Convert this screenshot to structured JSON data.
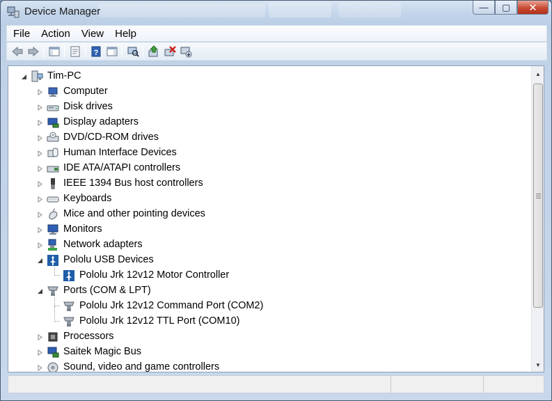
{
  "window": {
    "title": "Device Manager",
    "controls": {
      "minimize": "—",
      "maximize": "▢",
      "close": "✕"
    }
  },
  "menu": [
    "File",
    "Action",
    "View",
    "Help"
  ],
  "toolbar": [
    {
      "icon": "back-arrow-icon"
    },
    {
      "icon": "forward-arrow-icon"
    },
    {
      "sep": true
    },
    {
      "icon": "show-hide-console-tree-icon"
    },
    {
      "sep": true
    },
    {
      "icon": "properties-icon"
    },
    {
      "sep": true
    },
    {
      "icon": "help-icon"
    },
    {
      "icon": "show-action-pane-icon"
    },
    {
      "sep": true
    },
    {
      "icon": "scan-hardware-changes-icon"
    },
    {
      "sep": true
    },
    {
      "icon": "update-driver-icon"
    },
    {
      "icon": "disable-device-icon"
    },
    {
      "icon": "uninstall-device-icon"
    }
  ],
  "tree": {
    "root": "Tim-PC",
    "categories": [
      {
        "label": "Computer",
        "icon": "computer-icon",
        "expanded": false
      },
      {
        "label": "Disk drives",
        "icon": "disk-drive-icon",
        "expanded": false
      },
      {
        "label": "Display adapters",
        "icon": "display-adapter-icon",
        "expanded": false
      },
      {
        "label": "DVD/CD-ROM drives",
        "icon": "dvd-drive-icon",
        "expanded": false
      },
      {
        "label": "Human Interface Devices",
        "icon": "hid-icon",
        "expanded": false
      },
      {
        "label": "IDE ATA/ATAPI controllers",
        "icon": "ide-controller-icon",
        "expanded": false
      },
      {
        "label": "IEEE 1394 Bus host controllers",
        "icon": "ieee1394-icon",
        "expanded": false
      },
      {
        "label": "Keyboards",
        "icon": "keyboard-icon",
        "expanded": false
      },
      {
        "label": "Mice and other pointing devices",
        "icon": "mouse-icon",
        "expanded": false
      },
      {
        "label": "Monitors",
        "icon": "monitor-icon",
        "expanded": false
      },
      {
        "label": "Network adapters",
        "icon": "network-adapter-icon",
        "expanded": false
      },
      {
        "label": "Pololu USB Devices",
        "icon": "pololu-icon",
        "expanded": true,
        "children": [
          {
            "label": "Pololu Jrk 12v12 Motor Controller",
            "icon": "pololu-icon"
          }
        ]
      },
      {
        "label": "Ports (COM & LPT)",
        "icon": "port-icon",
        "expanded": true,
        "children": [
          {
            "label": "Pololu Jrk 12v12 Command Port (COM2)",
            "icon": "port-icon"
          },
          {
            "label": "Pololu Jrk 12v12 TTL Port (COM10)",
            "icon": "port-icon"
          }
        ]
      },
      {
        "label": "Processors",
        "icon": "processor-icon",
        "expanded": false
      },
      {
        "label": "Saitek Magic Bus",
        "icon": "saitek-icon",
        "expanded": false
      },
      {
        "label": "Sound, video and game controllers",
        "icon": "sound-icon",
        "expanded": false
      }
    ]
  },
  "colors": {
    "tree_background": "#ffffff",
    "window_frame": "#c5d7ea",
    "close_button": "#c94a33"
  }
}
